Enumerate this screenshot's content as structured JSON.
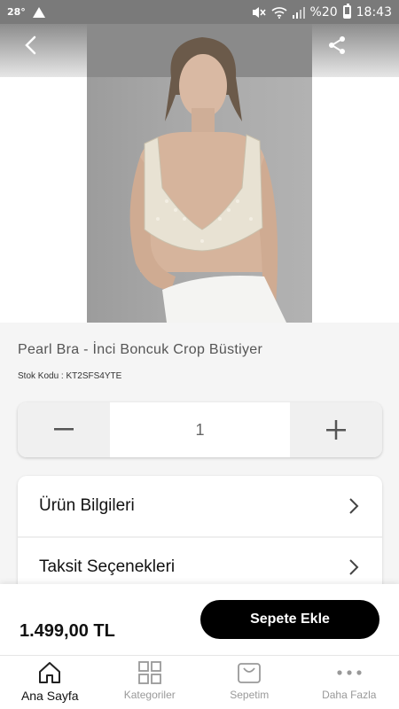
{
  "status_bar": {
    "temperature": "28°",
    "battery": "%20",
    "time": "18:43"
  },
  "product": {
    "title": "Pearl Bra - İnci Boncuk Crop Büstiyer",
    "sku": "Stok Kodu : KT2SFS4YTE",
    "price": "1.499,00 TL"
  },
  "quantity": {
    "value": "1",
    "minus_icon": "minus-icon",
    "plus_icon": "plus-icon"
  },
  "menu": {
    "items": [
      {
        "label": "Ürün Bilgileri"
      },
      {
        "label": "Taksit Seçenekleri"
      }
    ]
  },
  "actions": {
    "add_to_cart": "Sepete Ekle"
  },
  "tabbar": {
    "items": [
      {
        "label": "Ana Sayfa",
        "icon": "home-icon",
        "active": true
      },
      {
        "label": "Kategoriler",
        "icon": "grid-icon",
        "active": false
      },
      {
        "label": "Sepetim",
        "icon": "shopping-bag-icon",
        "active": false
      },
      {
        "label": "Daha Fazla",
        "icon": "more-icon",
        "active": false
      }
    ]
  },
  "colors": {
    "accent": "#000000",
    "background": "#f5f5f5",
    "status_bar": "#7a7a7a"
  }
}
